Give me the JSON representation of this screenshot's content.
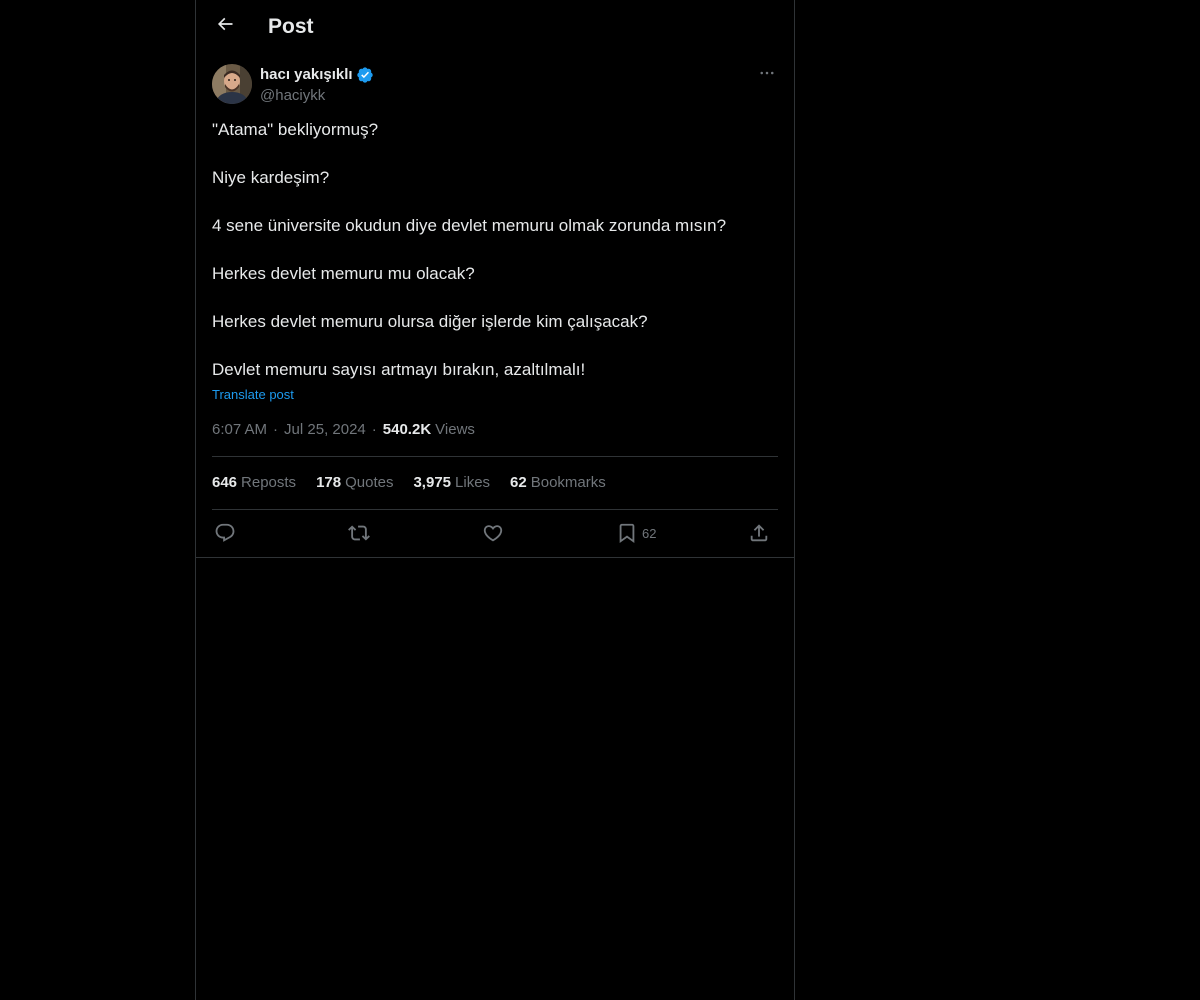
{
  "header": {
    "title": "Post",
    "back_icon": "arrow-left-icon"
  },
  "author": {
    "display_name": "hacı yakışıklı",
    "handle": "@haciykk",
    "verified_icon": "verified-badge-icon",
    "verified_color": "#1d9bf0",
    "more_icon": "more-horizontal-icon"
  },
  "post": {
    "paragraphs": [
      "\"Atama\" bekliyormuş?",
      "Niye kardeşim?",
      "4 sene üniversite okudun diye devlet memuru olmak zorunda mısın?",
      "Herkes devlet memuru mu olacak?",
      "Herkes devlet memuru olursa diğer işlerde kim çalışacak?",
      "Devlet memuru sayısı artmayı bırakın, azaltılmalı!"
    ],
    "translate_label": "Translate post",
    "time": "6:07 AM",
    "date": "Jul 25, 2024",
    "views_count": "540.2K",
    "views_label": "Views",
    "separator": "·"
  },
  "stats": {
    "reposts": {
      "count": "646",
      "label": "Reposts"
    },
    "quotes": {
      "count": "178",
      "label": "Quotes"
    },
    "likes": {
      "count": "3,975",
      "label": "Likes"
    },
    "bookmarks": {
      "count": "62",
      "label": "Bookmarks"
    }
  },
  "actions": {
    "reply_icon": "reply-icon",
    "repost_icon": "repost-icon",
    "like_icon": "heart-icon",
    "bookmark_icon": "bookmark-icon",
    "bookmark_count": "62",
    "share_icon": "share-icon"
  },
  "colors": {
    "background": "#000000",
    "text_primary": "#e7e9ea",
    "text_secondary": "#71767b",
    "border": "#2f3336",
    "accent": "#1d9bf0"
  }
}
